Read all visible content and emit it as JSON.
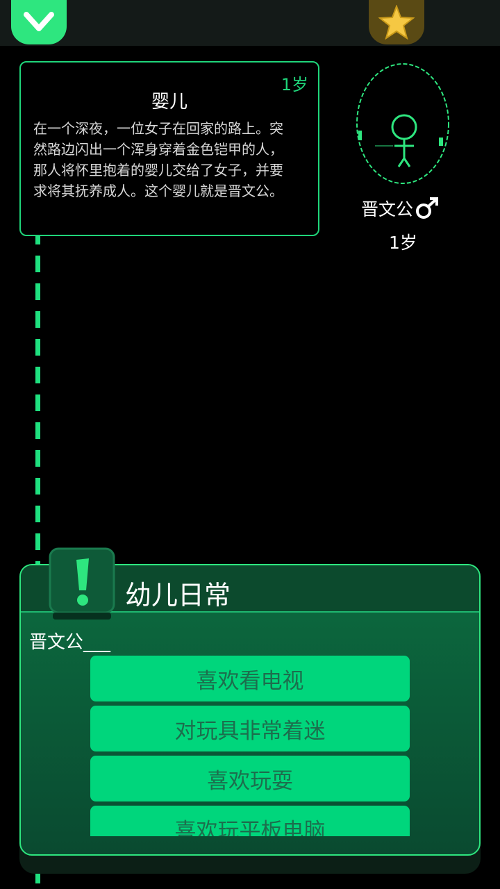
{
  "topbar": {
    "left_icon": "chevron-down-icon",
    "right_icon": "star-icon"
  },
  "event": {
    "age": "1岁",
    "title": "婴儿",
    "description": "在一个深夜，一位女子在回家的路上。突然路边闪出一个浑身穿着金色铠甲的人，那人将怀里抱着的婴儿交给了女子，并要求将其抚养成人。这个婴儿就是晋文公。"
  },
  "character": {
    "name": "晋文公",
    "gender_icon": "male-icon",
    "age": "1岁"
  },
  "panel": {
    "badge_icon": "exclamation-icon",
    "title": "幼儿日常",
    "prompt": "晋文公___",
    "choices": [
      "喜欢看电视",
      "对玩具非常着迷",
      "喜欢玩耍",
      "喜欢玩平板电脑"
    ]
  },
  "colors": {
    "accent": "#2ee67f",
    "choice_bg": "#00d67c",
    "choice_text": "#1c6e4d",
    "star": "#f5c843"
  }
}
